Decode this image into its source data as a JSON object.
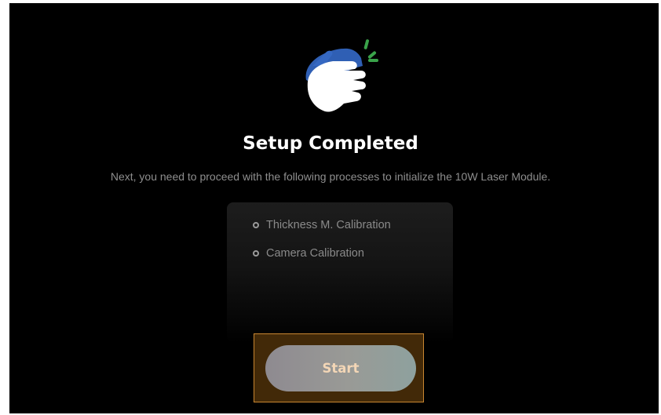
{
  "title": "Setup Completed",
  "subtitle": "Next, you need to proceed with the following processes to initialize the 10W Laser Module.",
  "steps": [
    {
      "label": "Thickness M. Calibration"
    },
    {
      "label": "Camera Calibration"
    }
  ],
  "start_button": {
    "label": "Start",
    "state": "focused"
  },
  "icon": {
    "name": "clapping-hands-icon"
  },
  "colors": {
    "background": "#000000",
    "title": "#ffffff",
    "subtitle": "#8e8e8e",
    "step_text": "#8a8a8a",
    "button_text": "#f3d6b6",
    "focus_border": "#c98630",
    "icon_blue": "#2f5fb4",
    "icon_green": "#3aa34a"
  }
}
